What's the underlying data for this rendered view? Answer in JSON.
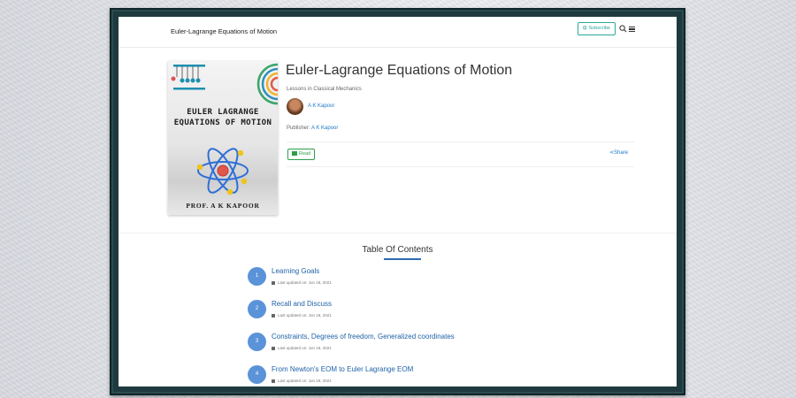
{
  "header": {
    "site_title": "Euler-Lagrange Equations of Motion",
    "subscribe_label": "Subscribe",
    "icons": [
      "search-icon",
      "menu-icon",
      "subscribe-icon"
    ]
  },
  "book": {
    "cover_title": "EULER LAGRANGE EQUATIONS OF MOTION",
    "cover_author": "PROF. A K KAPOOR",
    "title": "Euler-Lagrange Equations of Motion",
    "subtitle": "Lessons in Classical Mechanics",
    "author": "A K Kapoor",
    "publisher_label": "Publisher:",
    "publisher": "A K Kapoor",
    "read_label": "Read",
    "share_label": "Share"
  },
  "toc": {
    "heading": "Table Of Contents",
    "items": [
      {
        "number": "1",
        "title": "Learning Goals",
        "updated": "Last updated on: Jun 18, 2021"
      },
      {
        "number": "2",
        "title": "Recall and Discuss",
        "updated": "Last updated on: Jun 18, 2021"
      },
      {
        "number": "3",
        "title": "Constraints, Degrees of freedom, Generalized coordinates",
        "updated": "Last updated on: Jun 18, 2021"
      },
      {
        "number": "4",
        "title": "From Newton's EOM to Euler Lagrange EOM",
        "updated": "Last updated on: Jun 19, 2021"
      }
    ]
  },
  "colors": {
    "frame": "#1f3a3e",
    "link": "#1f78c8",
    "accent_teal": "#2aa89a",
    "read_green": "#2e9e49",
    "toc_badge": "#5b93d9"
  }
}
